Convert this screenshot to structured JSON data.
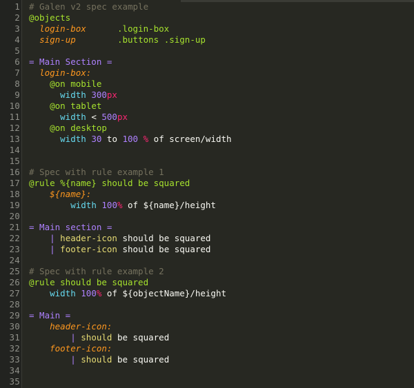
{
  "editor": {
    "theme_name": "monokai",
    "background": "#272822",
    "gutter_background": "#222320",
    "gutter_text_color": "#8e8f88",
    "default_text_color": "#f8f8f2",
    "total_lines": 35,
    "scrollbar": {
      "name": "horizontal-scrollbar",
      "visible": true
    }
  },
  "colors": {
    "comment": "#75715e",
    "keyword": "#a6e22e",
    "object": "#fd971f",
    "selector": "#a6e22e",
    "section": "#ae81ff",
    "property": "#66d9ef",
    "number": "#ae81ff",
    "unit": "#f92672",
    "plain": "#f8f8f2",
    "pipe": "#ae81ff",
    "should": "#e6db74"
  },
  "lines": [
    {
      "n": "1",
      "tokens": [
        {
          "t": "# Galen v2 spec example",
          "c": "t-comment"
        }
      ]
    },
    {
      "n": "2",
      "tokens": [
        {
          "t": "@objects",
          "c": "t-keyword"
        }
      ]
    },
    {
      "n": "3",
      "tokens": [
        {
          "t": "  ",
          "c": "t-plain"
        },
        {
          "t": "login-box",
          "c": "t-object"
        },
        {
          "t": "      ",
          "c": "t-plain"
        },
        {
          "t": ".login-box",
          "c": "t-selector"
        }
      ]
    },
    {
      "n": "4",
      "tokens": [
        {
          "t": "  ",
          "c": "t-plain"
        },
        {
          "t": "sign-up",
          "c": "t-object"
        },
        {
          "t": "        ",
          "c": "t-plain"
        },
        {
          "t": ".buttons .sign-up",
          "c": "t-selector"
        }
      ]
    },
    {
      "n": "5",
      "tokens": []
    },
    {
      "n": "6",
      "tokens": [
        {
          "t": "= Main Section =",
          "c": "t-section"
        }
      ]
    },
    {
      "n": "7",
      "tokens": [
        {
          "t": "  ",
          "c": "t-plain"
        },
        {
          "t": "login-box:",
          "c": "t-object"
        }
      ]
    },
    {
      "n": "8",
      "tokens": [
        {
          "t": "    ",
          "c": "t-plain"
        },
        {
          "t": "@on mobile",
          "c": "t-keyword"
        }
      ]
    },
    {
      "n": "9",
      "tokens": [
        {
          "t": "      ",
          "c": "t-plain"
        },
        {
          "t": "width",
          "c": "t-prop"
        },
        {
          "t": " ",
          "c": "t-plain"
        },
        {
          "t": "300",
          "c": "t-number"
        },
        {
          "t": "px",
          "c": "t-unit"
        }
      ]
    },
    {
      "n": "10",
      "tokens": [
        {
          "t": "    ",
          "c": "t-plain"
        },
        {
          "t": "@on tablet",
          "c": "t-keyword"
        }
      ]
    },
    {
      "n": "11",
      "tokens": [
        {
          "t": "      ",
          "c": "t-plain"
        },
        {
          "t": "width",
          "c": "t-prop"
        },
        {
          "t": " < ",
          "c": "t-plain"
        },
        {
          "t": "500",
          "c": "t-number"
        },
        {
          "t": "px",
          "c": "t-unit"
        }
      ]
    },
    {
      "n": "12",
      "tokens": [
        {
          "t": "    ",
          "c": "t-plain"
        },
        {
          "t": "@on desktop",
          "c": "t-keyword"
        }
      ]
    },
    {
      "n": "13",
      "tokens": [
        {
          "t": "      ",
          "c": "t-plain"
        },
        {
          "t": "width",
          "c": "t-prop"
        },
        {
          "t": " ",
          "c": "t-plain"
        },
        {
          "t": "30",
          "c": "t-number"
        },
        {
          "t": " to ",
          "c": "t-plain"
        },
        {
          "t": "100",
          "c": "t-number"
        },
        {
          "t": " ",
          "c": "t-plain"
        },
        {
          "t": "%",
          "c": "t-unit"
        },
        {
          "t": " of screen/width",
          "c": "t-plain"
        }
      ]
    },
    {
      "n": "14",
      "tokens": []
    },
    {
      "n": "15",
      "tokens": []
    },
    {
      "n": "16",
      "tokens": [
        {
          "t": "# Spec with rule example 1",
          "c": "t-comment"
        }
      ]
    },
    {
      "n": "17",
      "tokens": [
        {
          "t": "@rule %{name} should be squared",
          "c": "t-keyword"
        }
      ]
    },
    {
      "n": "18",
      "tokens": [
        {
          "t": "    ",
          "c": "t-plain"
        },
        {
          "t": "${name}:",
          "c": "t-object"
        }
      ]
    },
    {
      "n": "19",
      "tokens": [
        {
          "t": "        ",
          "c": "t-plain"
        },
        {
          "t": "width",
          "c": "t-prop"
        },
        {
          "t": " ",
          "c": "t-plain"
        },
        {
          "t": "100",
          "c": "t-number"
        },
        {
          "t": "%",
          "c": "t-unit"
        },
        {
          "t": " of ${name}/height",
          "c": "t-plain"
        }
      ]
    },
    {
      "n": "20",
      "tokens": []
    },
    {
      "n": "21",
      "tokens": [
        {
          "t": "= Main section =",
          "c": "t-section"
        }
      ]
    },
    {
      "n": "22",
      "tokens": [
        {
          "t": "    ",
          "c": "t-plain"
        },
        {
          "t": "|",
          "c": "t-pipe"
        },
        {
          "t": " ",
          "c": "t-plain"
        },
        {
          "t": "header-icon",
          "c": "t-name"
        },
        {
          "t": " should be squared",
          "c": "t-plain"
        }
      ]
    },
    {
      "n": "23",
      "tokens": [
        {
          "t": "    ",
          "c": "t-plain"
        },
        {
          "t": "|",
          "c": "t-pipe"
        },
        {
          "t": " ",
          "c": "t-plain"
        },
        {
          "t": "footer-icon",
          "c": "t-name"
        },
        {
          "t": " should be squared",
          "c": "t-plain"
        }
      ]
    },
    {
      "n": "24",
      "tokens": []
    },
    {
      "n": "25",
      "tokens": [
        {
          "t": "# Spec with rule example 2",
          "c": "t-comment"
        }
      ]
    },
    {
      "n": "26",
      "tokens": [
        {
          "t": "@rule should be squared",
          "c": "t-keyword"
        }
      ]
    },
    {
      "n": "27",
      "tokens": [
        {
          "t": "    ",
          "c": "t-plain"
        },
        {
          "t": "width",
          "c": "t-prop"
        },
        {
          "t": " ",
          "c": "t-plain"
        },
        {
          "t": "100",
          "c": "t-number"
        },
        {
          "t": "%",
          "c": "t-unit"
        },
        {
          "t": " of ${objectName}/height",
          "c": "t-plain"
        }
      ]
    },
    {
      "n": "28",
      "tokens": []
    },
    {
      "n": "29",
      "tokens": [
        {
          "t": "= Main =",
          "c": "t-section"
        }
      ]
    },
    {
      "n": "30",
      "tokens": [
        {
          "t": "    ",
          "c": "t-plain"
        },
        {
          "t": "header-icon:",
          "c": "t-object"
        }
      ]
    },
    {
      "n": "31",
      "tokens": [
        {
          "t": "        ",
          "c": "t-plain"
        },
        {
          "t": "|",
          "c": "t-pipe"
        },
        {
          "t": " ",
          "c": "t-plain"
        },
        {
          "t": "should",
          "c": "t-should"
        },
        {
          "t": " be squared",
          "c": "t-plain"
        }
      ]
    },
    {
      "n": "32",
      "tokens": [
        {
          "t": "    ",
          "c": "t-plain"
        },
        {
          "t": "footer-icon:",
          "c": "t-object"
        }
      ]
    },
    {
      "n": "33",
      "tokens": [
        {
          "t": "        ",
          "c": "t-plain"
        },
        {
          "t": "|",
          "c": "t-pipe"
        },
        {
          "t": " ",
          "c": "t-plain"
        },
        {
          "t": "should",
          "c": "t-should"
        },
        {
          "t": " be squared",
          "c": "t-plain"
        }
      ]
    },
    {
      "n": "34",
      "tokens": []
    },
    {
      "n": "35",
      "tokens": []
    }
  ]
}
